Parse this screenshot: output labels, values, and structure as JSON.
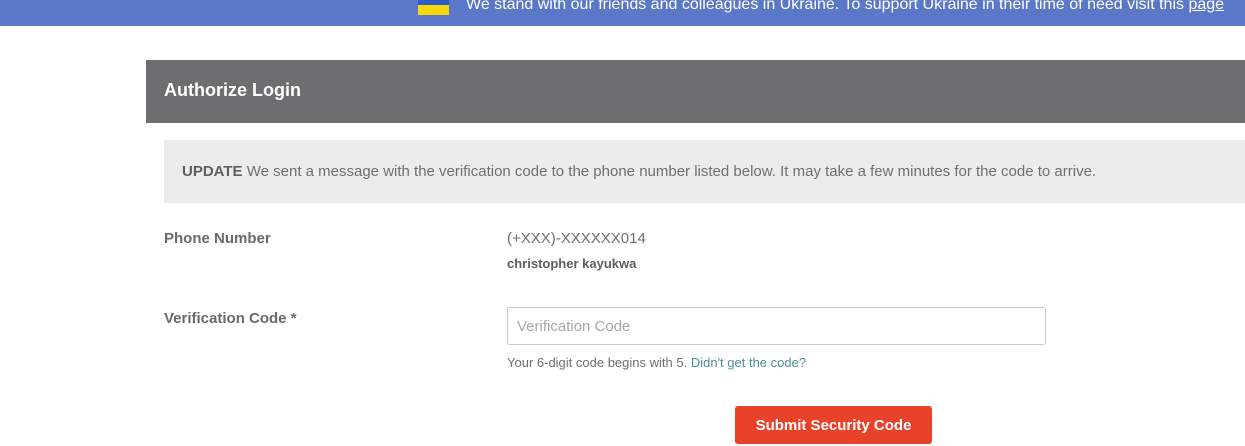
{
  "banner": {
    "text": "We stand with our friends and colleagues in Ukraine. To support Ukraine in their time of need visit this",
    "link_text": "page"
  },
  "panel": {
    "title": "Authorize Login"
  },
  "alert": {
    "label": "UPDATE",
    "message": "We sent a message with the verification code to the phone number listed below. It may take a few minutes for the code to arrive."
  },
  "phone": {
    "label": "Phone Number",
    "number": "(+XXX)-XXXXXX014",
    "name": "christopher kayukwa"
  },
  "verification": {
    "label": "Verification Code *",
    "placeholder": "Verification Code",
    "hint_text": "Your 6-digit code begins with 5.",
    "hint_link": "Didn't get the code?"
  },
  "submit": {
    "label": "Submit Security Code"
  },
  "colors": {
    "banner_bg": "#5a78c7",
    "header_bg": "#6d6e70",
    "alert_bg": "#ececec",
    "submit_bg": "#e8422b",
    "link": "#4c8f99"
  }
}
